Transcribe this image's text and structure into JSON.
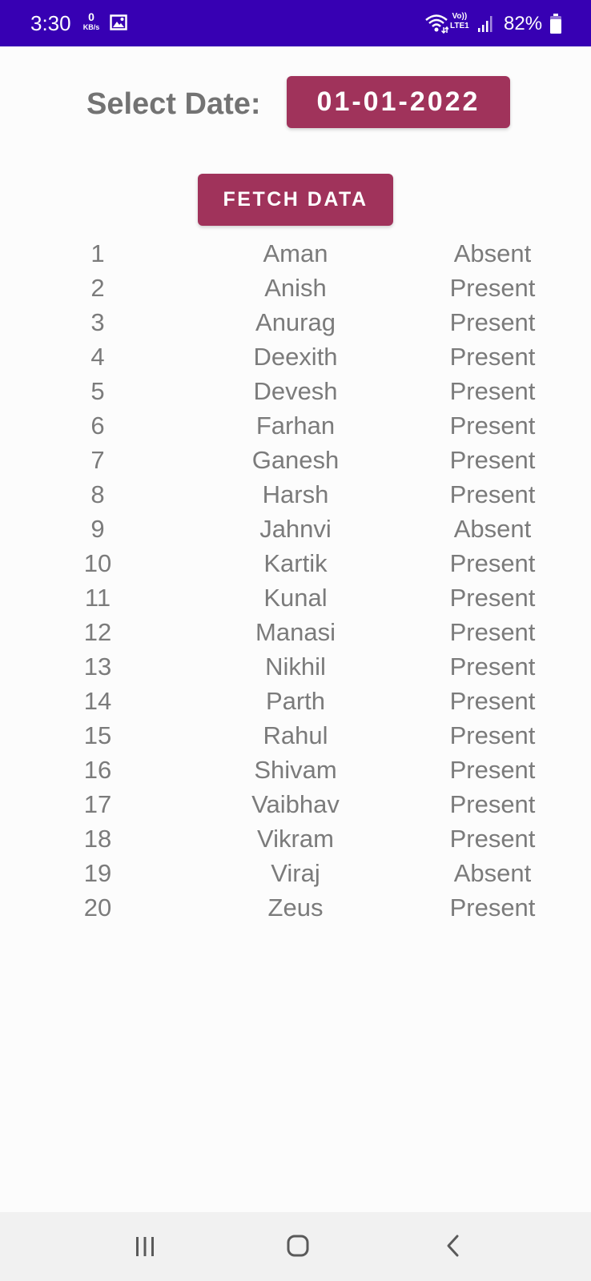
{
  "status_bar": {
    "time": "3:30",
    "net_speed": "0",
    "net_unit": "KB/s",
    "volte_top": "Vo))",
    "volte_bottom": "LTE1",
    "battery": "82%",
    "background_color": "#3700b3",
    "icons": [
      "image-icon",
      "wifi-icon",
      "signal-icon",
      "battery-icon"
    ]
  },
  "date_select": {
    "label": "Select Date:",
    "value": "01-01-2022"
  },
  "fetch_button": {
    "label": "FETCH DATA"
  },
  "accent_color": "#a0335b",
  "attendance": [
    {
      "num": "1",
      "name": "Aman",
      "status": "Absent"
    },
    {
      "num": "2",
      "name": "Anish",
      "status": "Present"
    },
    {
      "num": "3",
      "name": "Anurag",
      "status": "Present"
    },
    {
      "num": "4",
      "name": "Deexith",
      "status": "Present"
    },
    {
      "num": "5",
      "name": "Devesh",
      "status": "Present"
    },
    {
      "num": "6",
      "name": "Farhan",
      "status": "Present"
    },
    {
      "num": "7",
      "name": "Ganesh",
      "status": "Present"
    },
    {
      "num": "8",
      "name": "Harsh",
      "status": "Present"
    },
    {
      "num": "9",
      "name": "Jahnvi",
      "status": "Absent"
    },
    {
      "num": "10",
      "name": "Kartik",
      "status": "Present"
    },
    {
      "num": "11",
      "name": "Kunal",
      "status": "Present"
    },
    {
      "num": "12",
      "name": "Manasi",
      "status": "Present"
    },
    {
      "num": "13",
      "name": "Nikhil",
      "status": "Present"
    },
    {
      "num": "14",
      "name": "Parth",
      "status": "Present"
    },
    {
      "num": "15",
      "name": "Rahul",
      "status": "Present"
    },
    {
      "num": "16",
      "name": "Shivam",
      "status": "Present"
    },
    {
      "num": "17",
      "name": "Vaibhav",
      "status": "Present"
    },
    {
      "num": "18",
      "name": "Vikram",
      "status": "Present"
    },
    {
      "num": "19",
      "name": "Viraj",
      "status": "Absent"
    },
    {
      "num": "20",
      "name": "Zeus",
      "status": "Present"
    }
  ],
  "nav_bar": {
    "icons": [
      "recent-apps-icon",
      "home-icon",
      "back-icon"
    ]
  }
}
